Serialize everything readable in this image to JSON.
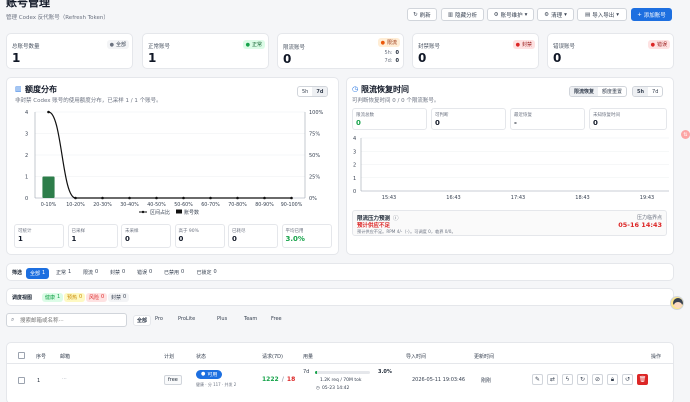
{
  "header": {
    "title": "账号管理",
    "subtitle": "管理 Codex 反代账号（Refresh Token）",
    "buttons": {
      "refresh": "刷新",
      "hide_analysis": "隐藏分析",
      "account_maint": "账号维护",
      "cleanup": "清理",
      "import_export": "导入导出",
      "add_account": "添加账号"
    }
  },
  "stats": [
    {
      "label": "总账号数量",
      "value": "1",
      "badge": "全部",
      "color": "#6b7280"
    },
    {
      "label": "正常账号",
      "value": "1",
      "badge": "正常",
      "color": "#16a34a"
    },
    {
      "label": "限流账号",
      "value": "0",
      "badge": "限流",
      "color": "#ea580c",
      "extra1": "5h:",
      "extra1_val": "0",
      "extra2": "7d:",
      "extra2_val": "0"
    },
    {
      "label": "封禁账号",
      "value": "0",
      "badge": "封禁",
      "color": "#dc2626"
    },
    {
      "label": "错误账号",
      "value": "0",
      "badge": "错误",
      "color": "#dc2626"
    }
  ],
  "quota": {
    "title": "额度分布",
    "subtitle": "非封禁 Codex 账号的使用额度分布，已采样 1 / 1 个账号。",
    "range_options": [
      "5h",
      "7d"
    ],
    "legend_line": "区间占比",
    "legend_bar": "账号数",
    "metrics": [
      {
        "label": "可统计",
        "value": "1"
      },
      {
        "label": "已采样",
        "value": "1"
      },
      {
        "label": "未采样",
        "value": "0"
      },
      {
        "label": "高于 90%",
        "value": "0"
      },
      {
        "label": "已耗尽",
        "value": "0"
      },
      {
        "label": "平均已用",
        "value": "3.0%"
      }
    ]
  },
  "chart_data": {
    "type": "bar",
    "categories": [
      "0-10%",
      "10-20%",
      "20-30%",
      "30-40%",
      "40-50%",
      "50-60%",
      "60-70%",
      "70-80%",
      "80-90%",
      "90-100%"
    ],
    "series": [
      {
        "name": "账号数",
        "type": "bar",
        "values": [
          1,
          0,
          0,
          0,
          0,
          0,
          0,
          0,
          0,
          0
        ]
      },
      {
        "name": "区间占比",
        "type": "line",
        "values": [
          100,
          0,
          0,
          0,
          0,
          0,
          0,
          0,
          0,
          0
        ]
      }
    ],
    "y_left_ticks": [
      "0",
      "1",
      "2",
      "3",
      "4"
    ],
    "y_right_ticks": [
      "0%",
      "25%",
      "50%",
      "75%",
      "100%"
    ],
    "ylim_left": [
      0,
      4
    ],
    "ylim_right": [
      0,
      100
    ],
    "legend_position": "bottom",
    "bar_color": "#2d7d4a",
    "line_color": "#111111"
  },
  "recovery": {
    "title": "限流恢复时间",
    "subtitle": "可判断恢复时间 0 / 0 个限流账号。",
    "tabs": [
      "限流恢复",
      "额度重置"
    ],
    "range_options": [
      "5h",
      "7d"
    ],
    "metrics": [
      {
        "label": "限流总数",
        "value": "0",
        "color": "#16a34a"
      },
      {
        "label": "可判断",
        "value": "0",
        "color": "#111827"
      },
      {
        "label": "最近恢复",
        "value": "-",
        "color": "#111827"
      },
      {
        "label": "未知恢复时间",
        "value": "0",
        "color": "#111827"
      }
    ],
    "y_ticks": [
      "0",
      "1",
      "2",
      "3",
      "4"
    ],
    "x_ticks": [
      "15:43",
      "16:43",
      "17:43",
      "18:43",
      "19:43"
    ],
    "pressure_title": "限流压力预测",
    "pressure_status": "预计供应不足",
    "pressure_desc": "预计供应不足。RPM 4/-（-）。可调度 0，临界 0/0。",
    "critical_label": "压力临界点",
    "critical_time": "05-16 14:43"
  },
  "filters": {
    "label": "筛选",
    "items": [
      {
        "label": "全部",
        "count": "1",
        "active": true
      },
      {
        "label": "正常",
        "count": "1"
      },
      {
        "label": "限流",
        "count": "0"
      },
      {
        "label": "封禁",
        "count": "0"
      },
      {
        "label": "错误",
        "count": "0"
      },
      {
        "label": "已禁用",
        "count": "0"
      },
      {
        "label": "已锁定",
        "count": "0"
      }
    ],
    "sched_label": "调度视图",
    "sched_items": [
      {
        "label": "健康",
        "count": "1",
        "color": "#16a34a",
        "bg": "#dcfce7"
      },
      {
        "label": "预热",
        "count": "0",
        "color": "#ca8a04",
        "bg": "#fef9c3"
      },
      {
        "label": "风险",
        "count": "0",
        "color": "#dc2626",
        "bg": "#fee2e2"
      },
      {
        "label": "封禁",
        "count": "0",
        "color": "#374151",
        "bg": "#f3f4f6"
      }
    ]
  },
  "search": {
    "placeholder": "搜索邮箱或名称···",
    "plans": [
      "全部",
      "Pro",
      "ProLite",
      "Plus",
      "Team",
      "Free"
    ]
  },
  "table": {
    "columns": [
      "序号",
      "邮箱",
      "计划",
      "状态",
      "请求(7D)",
      "用量",
      "导入时间",
      "更新时间",
      "操作"
    ],
    "rows": [
      {
        "index": "1",
        "email": "···",
        "plan": "free",
        "status": "可用",
        "status_sub": "健康 · 分 117 · 并发 2",
        "req_ok": "1222",
        "req_sep": "/",
        "req_fail": "18",
        "usage_label": "7d",
        "usage_pct": "3.0%",
        "usage_fill": 0.03,
        "usage_rate": "1.2K req / 70M tok",
        "usage_reset": "05-23 14:42",
        "import_time": "2026-05-11 19:03:46",
        "update_time": "刚刚"
      }
    ]
  }
}
